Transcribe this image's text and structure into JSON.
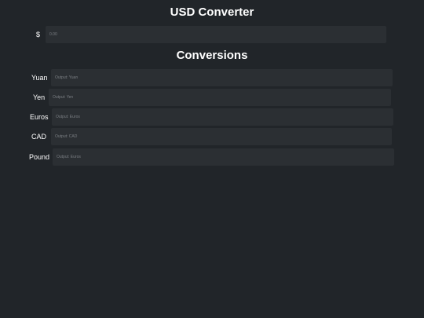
{
  "header": {
    "title": "USD Converter"
  },
  "usd": {
    "symbol": "$",
    "placeholder": "0.00"
  },
  "conversions": {
    "title": "Conversions",
    "rows": [
      {
        "label": "Yuan",
        "placeholder": "Output: Yuan"
      },
      {
        "label": "Yen",
        "placeholder": "Output: Yen"
      },
      {
        "label": "Euros",
        "placeholder": "Output: Euros"
      },
      {
        "label": "CAD",
        "placeholder": "Output: CAD"
      },
      {
        "label": "Pound",
        "placeholder": "Output: Euros"
      }
    ]
  }
}
